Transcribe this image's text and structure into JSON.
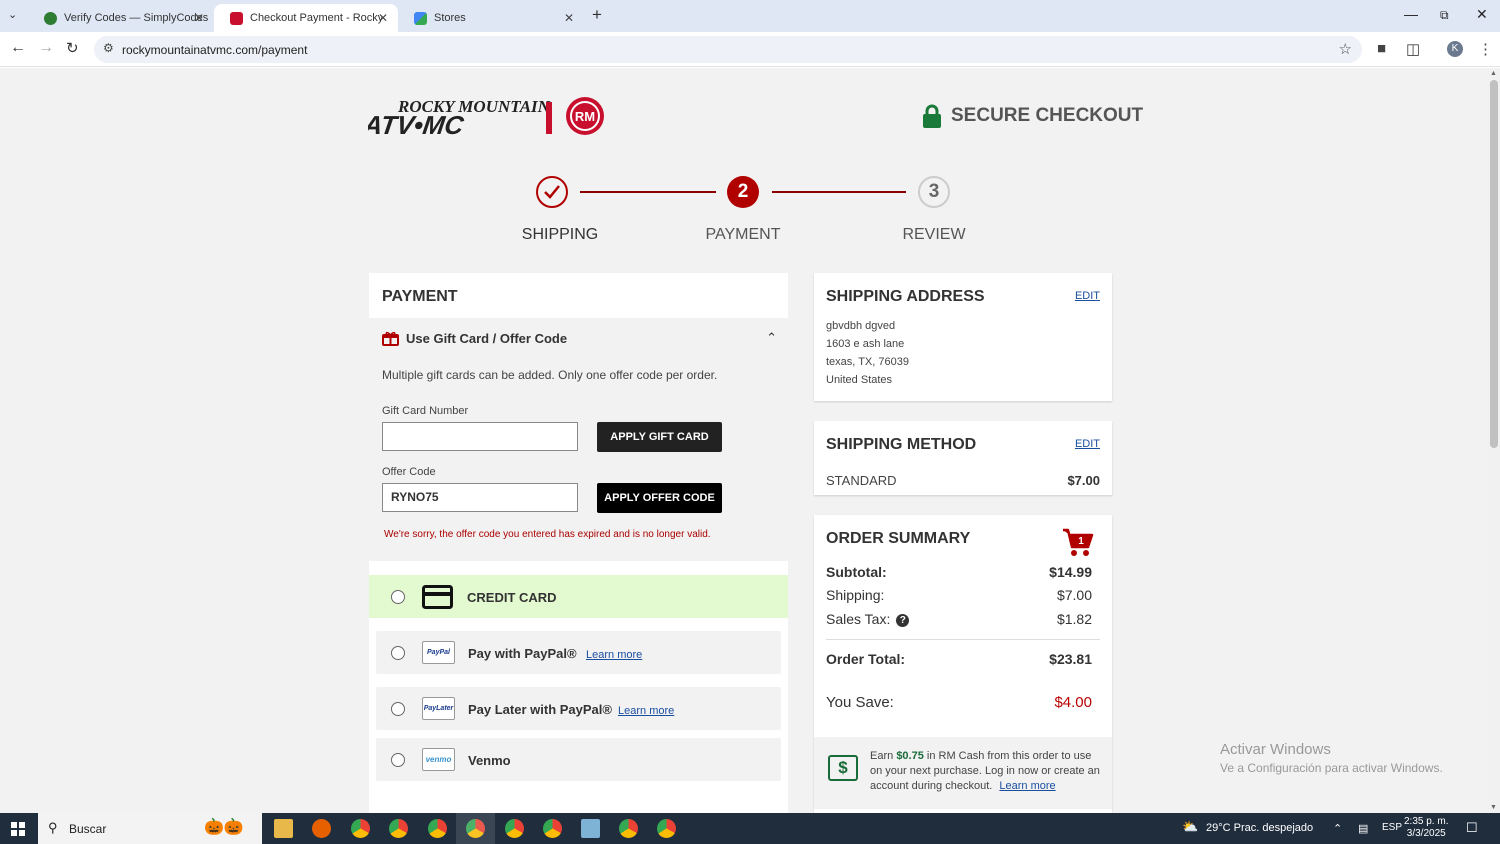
{
  "browser": {
    "tabs": [
      {
        "title": "Verify Codes — SimplyCodes",
        "color": "#2e7d32"
      },
      {
        "title": "Checkout Payment - Rocky Mou",
        "color": "#c8102e"
      },
      {
        "title": "Stores",
        "color": "#4285f4"
      }
    ],
    "url": "rockymountainatvmc.com/payment",
    "avatar_letter": "K"
  },
  "header": {
    "logo_text": "ROCKY MOUNTAIN ATV•MC",
    "logo_badge": "RM",
    "secure_label": "SECURE CHECKOUT"
  },
  "steps": [
    {
      "number": "✓",
      "label": "SHIPPING",
      "state": "done"
    },
    {
      "number": "2",
      "label": "PAYMENT",
      "state": "current"
    },
    {
      "number": "3",
      "label": "REVIEW",
      "state": "pending"
    }
  ],
  "payment": {
    "title": "PAYMENT",
    "gift_header": "Use Gift Card / Offer Code",
    "gift_note": "Multiple gift cards can be added. Only one offer code per order.",
    "gift_card_label": "Gift Card Number",
    "gift_card_value": "",
    "apply_gift_label": "APPLY GIFT CARD",
    "offer_code_label": "Offer Code",
    "offer_code_value": "RYNO75",
    "apply_offer_label": "APPLY OFFER CODE",
    "error": "We're sorry, the offer code you entered has expired and is no longer valid.",
    "options": [
      {
        "label": "CREDIT CARD"
      },
      {
        "label": "Pay with PayPal®",
        "learn": "Learn more",
        "icon": "PayPal"
      },
      {
        "label": "Pay Later with PayPal®",
        "learn": "Learn more",
        "icon": "PayLater"
      },
      {
        "label": "Venmo",
        "icon": "venmo"
      }
    ]
  },
  "shipping_address": {
    "title": "SHIPPING ADDRESS",
    "edit": "EDIT",
    "lines": [
      "gbvdbh dgved",
      "1603 e ash lane",
      "texas, TX, 76039",
      "United States"
    ]
  },
  "shipping_method": {
    "title": "SHIPPING METHOD",
    "edit": "EDIT",
    "method": "STANDARD",
    "price": "$7.00"
  },
  "order_summary": {
    "title": "ORDER SUMMARY",
    "cart_count": "1",
    "subtotal_label": "Subtotal:",
    "subtotal": "$14.99",
    "shipping_label": "Shipping:",
    "shipping": "$7.00",
    "tax_label": "Sales Tax:",
    "tax": "$1.82",
    "help": "?",
    "total_label": "Order Total:",
    "total": "$23.81",
    "save_label": "You Save:",
    "save": "$4.00",
    "earn_pre": "Earn",
    "earn_amount": "$0.75",
    "earn_post": "in RM Cash from this order to use on your next purchase. Log in now or create an account during checkout.",
    "earn_link": "Learn more"
  },
  "watermark": {
    "line1": "Activar Windows",
    "line2": "Ve a Configuración para activar Windows."
  },
  "taskbar": {
    "search_placeholder": "Buscar",
    "weather": "29°C  Prac. despejado",
    "lang": "ESP",
    "time": "2:35 p. m.",
    "date": "3/3/2025"
  },
  "colors": {
    "brand_red": "#b00000",
    "success_green": "#e3f9d0",
    "link_blue": "#1a4fa0"
  }
}
